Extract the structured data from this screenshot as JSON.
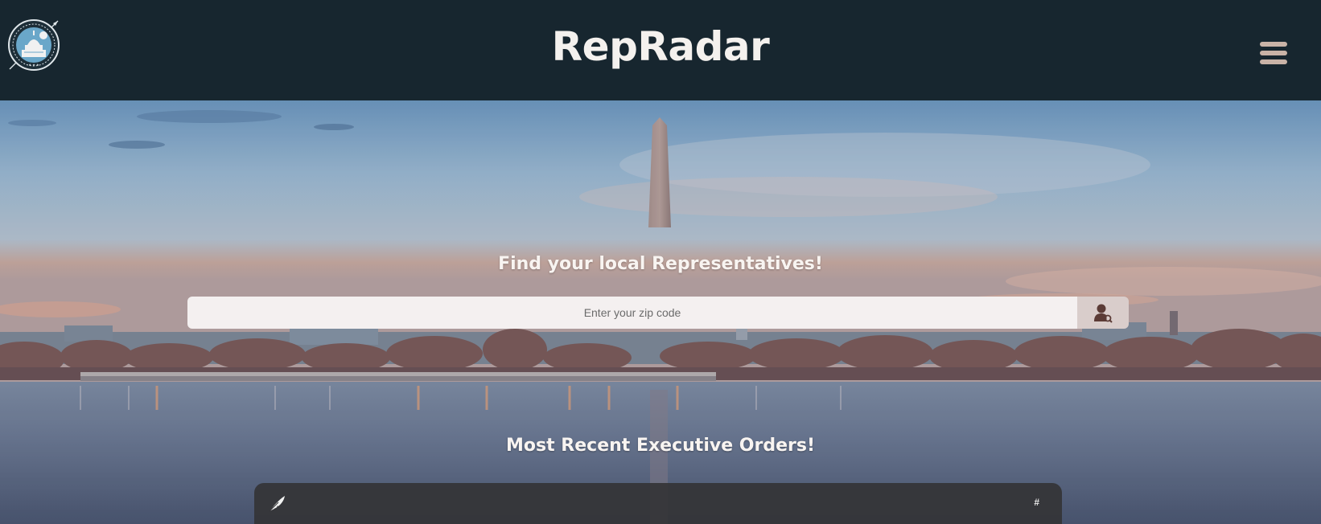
{
  "header": {
    "title": "RepRadar",
    "logo_icon": "capitol-compass-logo",
    "menu_icon": "hamburger-menu-icon"
  },
  "hero": {
    "find_heading": "Find your local Representatives!",
    "search": {
      "placeholder": "Enter your zip code",
      "value": "",
      "button_icon": "representative-search-icon"
    },
    "orders_heading": "Most Recent Executive Orders!"
  },
  "orders_table": {
    "header_icon": "quill-feather-icon",
    "number_column_label": "#"
  },
  "colors": {
    "header_bg": "#17262f",
    "title_text": "#f4f1ee",
    "menu_icon": "#c9b3a7",
    "input_bg": "#f4f0f0",
    "search_button_bg": "#d9cdcb",
    "card_bg": "#343436"
  }
}
